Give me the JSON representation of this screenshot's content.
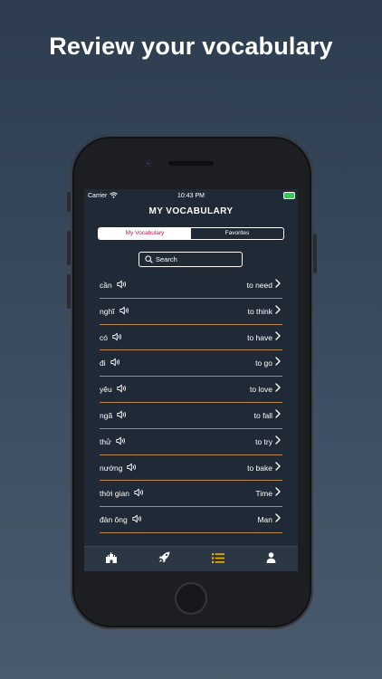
{
  "headline": "Review your vocabulary",
  "status": {
    "carrier": "Carrier",
    "time": "10:43 PM"
  },
  "screen_title": "MY VOCABULARY",
  "segments": {
    "active": "My Vocabulary",
    "inactive": "Favorites"
  },
  "search": {
    "placeholder": "Search"
  },
  "items": [
    {
      "word": "cần",
      "meaning": "to need"
    },
    {
      "word": "nghĩ",
      "meaning": "to think"
    },
    {
      "word": "có",
      "meaning": "to have"
    },
    {
      "word": "đi",
      "meaning": "to go"
    },
    {
      "word": "yêu",
      "meaning": "to love"
    },
    {
      "word": "ngã",
      "meaning": "to fall"
    },
    {
      "word": "thử",
      "meaning": "to try"
    },
    {
      "word": "nướng",
      "meaning": "to bake"
    },
    {
      "word": "thời gian",
      "meaning": "Time"
    },
    {
      "word": "đàn ông",
      "meaning": "Man"
    }
  ],
  "tabs": [
    "castle-icon",
    "rocket-icon",
    "list-icon",
    "user-icon"
  ],
  "colors": {
    "accent": "#c2185b",
    "active_tab": "#f0b400",
    "divider": "#b9874a",
    "battery": "#3ac45a"
  }
}
